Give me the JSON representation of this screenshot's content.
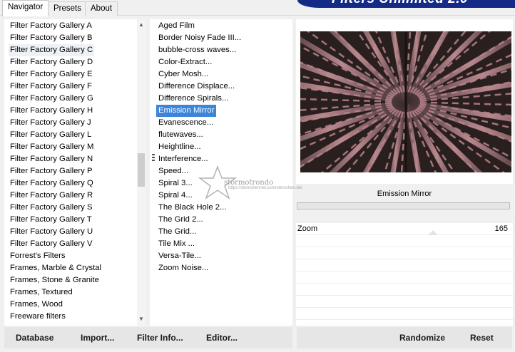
{
  "tabs": [
    "Navigator",
    "Presets",
    "About"
  ],
  "banner_title": "Filters Unlimited 2.0",
  "categories": [
    "Filter Factory Gallery A",
    "Filter Factory Gallery B",
    "Filter Factory Gallery C",
    "Filter Factory Gallery D",
    "Filter Factory Gallery E",
    "Filter Factory Gallery F",
    "Filter Factory Gallery G",
    "Filter Factory Gallery H",
    "Filter Factory Gallery J",
    "Filter Factory Gallery L",
    "Filter Factory Gallery M",
    "Filter Factory Gallery N",
    "Filter Factory Gallery P",
    "Filter Factory Gallery Q",
    "Filter Factory Gallery R",
    "Filter Factory Gallery S",
    "Filter Factory Gallery T",
    "Filter Factory Gallery U",
    "Filter Factory Gallery V",
    "Forrest's Filters",
    "Frames, Marble & Crystal",
    "Frames, Stone & Granite",
    "Frames, Textured",
    "Frames, Wood",
    "Freeware filters"
  ],
  "highlighted_category": "Filter Factory Gallery C",
  "filters": [
    "Aged Film",
    "Border Noisy Fade III...",
    "bubble-cross waves...",
    "Color-Extract...",
    "Cyber Mosh...",
    "Difference Displace...",
    "Difference Spirals...",
    "Emission Mirror",
    "Evanescence...",
    "flutewaves...",
    "Heightline...",
    "Interference...",
    "Speed...",
    "Spiral 3...",
    "Spiral 4...",
    "The Black Hole 2...",
    "The Grid 2...",
    "The Grid...",
    "Tile Mix ...",
    "Versa-Tile...",
    "Zoom Noise..."
  ],
  "selected_filter": "Emission Mirror",
  "preview_title": "Emission Mirror",
  "parameters": [
    {
      "label": "Zoom",
      "value": "165"
    }
  ],
  "buttons": {
    "database": "Database",
    "import": "Import...",
    "filter_info": "Filter Info...",
    "editor": "Editor...",
    "randomize": "Randomize",
    "reset": "Reset"
  },
  "watermark": {
    "name": "stormotrondo",
    "url": "https://sternchennet.com/sternchen.de/"
  },
  "colors": {
    "selection": "#3d85d8",
    "banner": "#142a86",
    "preview_pink": "#c8949a",
    "preview_dark": "#2a1f1f"
  }
}
